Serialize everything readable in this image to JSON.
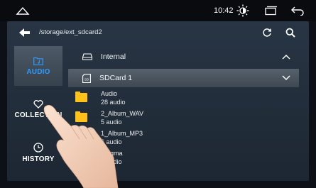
{
  "status": {
    "time": "10:42"
  },
  "path": "/storage/ext_sdcard2",
  "sidebar": {
    "items": [
      {
        "label": "AUDIO",
        "icon": "music-folder-icon",
        "active": true,
        "color": "#2f9bff"
      },
      {
        "label": "COLLECTION",
        "icon": "heart-icon",
        "active": false
      },
      {
        "label": "HISTORY",
        "icon": "clock-icon",
        "active": false
      }
    ]
  },
  "storage": [
    {
      "label": "Internal",
      "icon": "drive-icon",
      "state": "collapsed-up"
    },
    {
      "label": "SDCard 1",
      "icon": "sdcard-icon",
      "state": "expanded-down"
    }
  ],
  "files": [
    {
      "name": "Audio",
      "count": "28 audio"
    },
    {
      "name": "2_Album_WAV",
      "count": "5 audio"
    },
    {
      "name": "1_Album_MP3",
      "count": "6 audio"
    },
    {
      "name": "Enigma",
      "count": "2 audio"
    }
  ],
  "colors": {
    "accent": "#2f9bff",
    "folder": "#ffc21a"
  }
}
